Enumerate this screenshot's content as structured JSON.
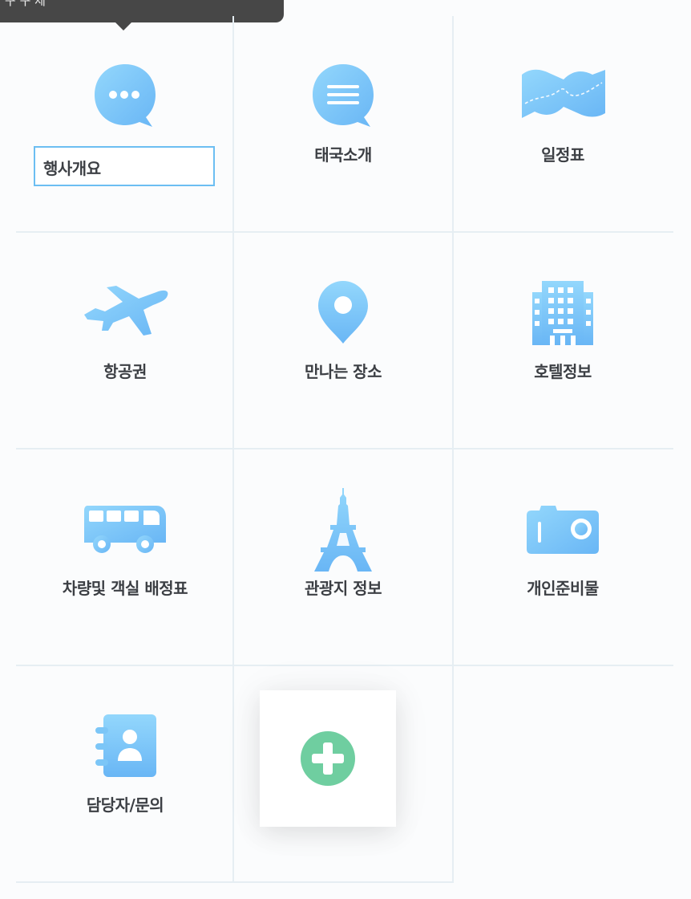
{
  "tooltip": {
    "text": "구 구 제"
  },
  "menu": {
    "items": [
      {
        "label": "행사개요",
        "icon": "chat-bubble-dots-icon"
      },
      {
        "label": "태국소개",
        "icon": "chat-bubble-lines-icon"
      },
      {
        "label": "일정표",
        "icon": "map-icon"
      },
      {
        "label": "항공권",
        "icon": "airplane-icon"
      },
      {
        "label": "만나는 장소",
        "icon": "location-pin-icon"
      },
      {
        "label": "호텔정보",
        "icon": "hotel-building-icon"
      },
      {
        "label": "차량및 객실 배정표",
        "icon": "bus-icon"
      },
      {
        "label": "관광지 정보",
        "icon": "eiffel-tower-icon"
      },
      {
        "label": "개인준비물",
        "icon": "camera-icon"
      },
      {
        "label": "담당자/문의",
        "icon": "contact-book-icon"
      }
    ]
  },
  "add_button": {
    "icon": "plus-circle-icon"
  },
  "colors": {
    "icon_gradient_start": "#8fd3fb",
    "icon_gradient_end": "#6cbaf6",
    "add_green": "#6fcea0",
    "label_text": "#3c3f44",
    "grid_line": "#e6eef3",
    "selected_border": "#6cbef2"
  }
}
